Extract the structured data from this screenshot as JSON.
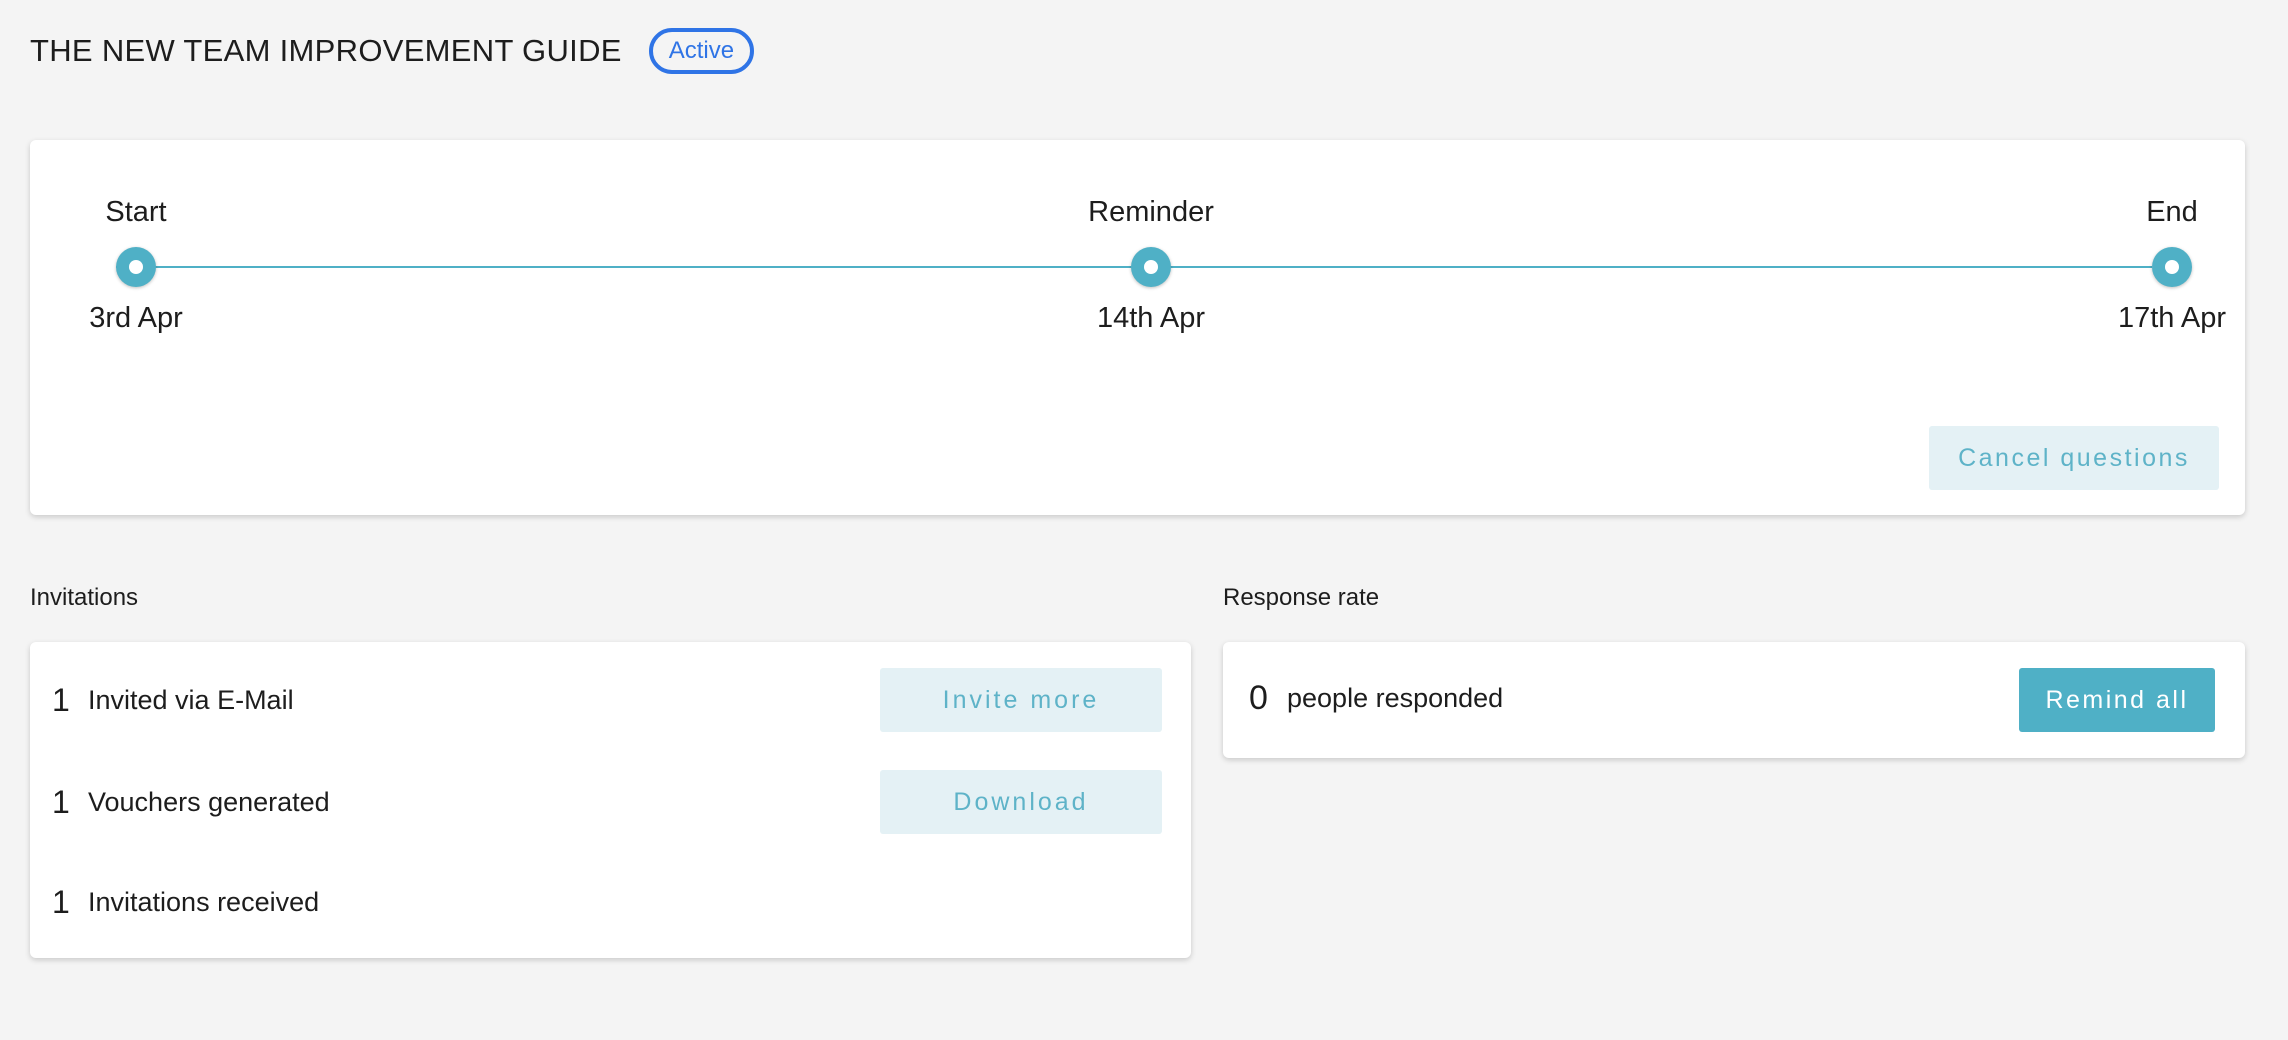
{
  "header": {
    "title": "THE NEW TEAM IMPROVEMENT GUIDE",
    "status": "Active"
  },
  "timeline": {
    "milestones": [
      {
        "label": "Start",
        "date": "3rd Apr"
      },
      {
        "label": "Reminder",
        "date": "14th Apr"
      },
      {
        "label": "End",
        "date": "17th Apr"
      }
    ],
    "cancel_label": "Cancel questions"
  },
  "invitations": {
    "section_label": "Invitations",
    "rows": [
      {
        "count": "1",
        "text": "Invited via E-Mail",
        "button": "Invite more"
      },
      {
        "count": "1",
        "text": "Vouchers generated",
        "button": "Download"
      },
      {
        "count": "1",
        "text": "Invitations received"
      }
    ]
  },
  "response": {
    "section_label": "Response rate",
    "count": "0",
    "text": "people responded",
    "button": "Remind all"
  },
  "colors": {
    "accent": "#4fb0c6",
    "accent_light_bg": "#e4f1f5",
    "badge_blue": "#2f74e6",
    "page_bg": "#f4f4f4"
  }
}
